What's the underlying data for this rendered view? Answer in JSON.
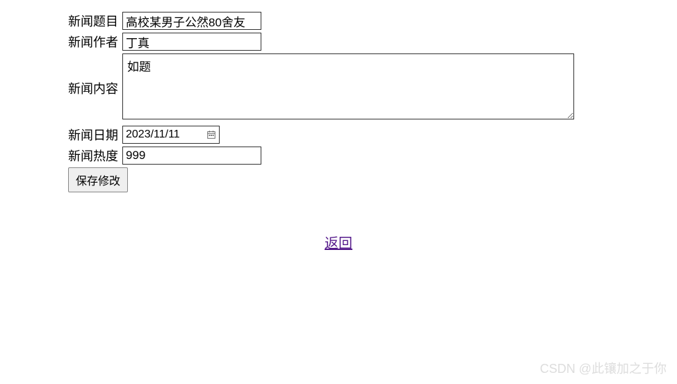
{
  "form": {
    "title": {
      "label": "新闻题目",
      "value": "高校某男子公然80舍友"
    },
    "author": {
      "label": "新闻作者",
      "value": "丁真"
    },
    "content": {
      "label": "新闻内容",
      "value": "如题"
    },
    "date": {
      "label": "新闻日期",
      "value": "2023/11/11"
    },
    "heat": {
      "label": "新闻热度",
      "value": "999"
    },
    "save_button": "保存修改"
  },
  "back_link": "返回",
  "watermark": "CSDN @此镶加之于你"
}
